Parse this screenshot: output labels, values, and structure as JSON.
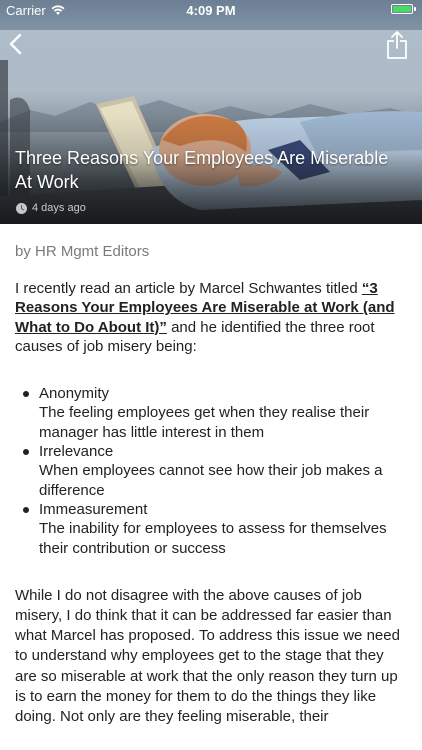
{
  "status_bar": {
    "carrier": "Carrier",
    "time": "4:09 PM",
    "battery_level": 1.0,
    "battery_color": "#4cd964"
  },
  "nav": {
    "back_icon": "chevron-left-icon",
    "share_icon": "share-icon"
  },
  "article": {
    "title": "Three Reasons Your Employees Are Miserable At Work",
    "posted": "4 days ago",
    "byline": "by HR Mgmt Editors",
    "intro_before_link": "I recently read an article by Marcel Schwantes titled ",
    "intro_link": "“3 Reasons Your Employees Are Miserable at Work (and What to Do About It)”",
    "intro_after_link": " and he identified the three root causes of job misery being:",
    "causes": [
      {
        "name": "Anonymity",
        "description": "The feeling employees get when they realise their manager has little interest in them"
      },
      {
        "name": "Irrelevance",
        "description": "When employees cannot see how their job makes a difference"
      },
      {
        "name": "Immeasurement",
        "description": "The inability for employees to assess for themselves their contribution or success"
      }
    ],
    "body": "While I do not disagree with the above causes of job misery, I do think that it can be addressed far easier than what Marcel has proposed. To address this issue we need to understand why employees get to the stage that they are so miserable at work that the only reason they turn up is to earn the money for them to do the things they like doing. Not only are they feeling miserable, their"
  }
}
